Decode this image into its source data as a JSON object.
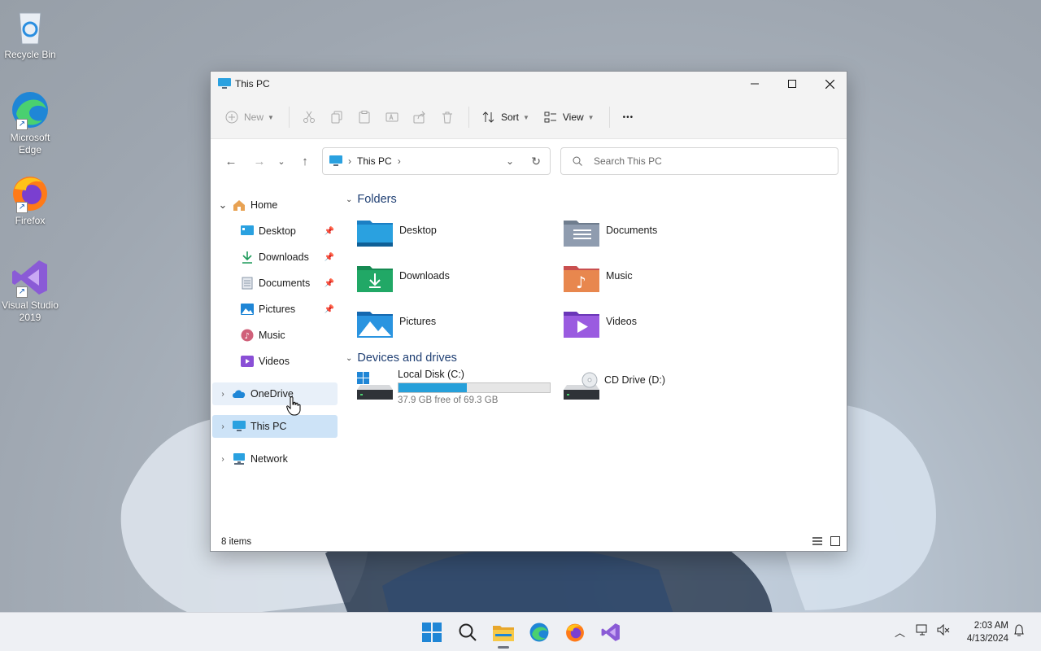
{
  "desktop": {
    "icons": [
      {
        "label": "Recycle Bin"
      },
      {
        "label": "Microsoft Edge"
      },
      {
        "label": "Firefox"
      },
      {
        "label": "Visual Studio 2019"
      }
    ]
  },
  "window": {
    "title": "This PC",
    "commandbar": {
      "new_label": "New",
      "sort_label": "Sort",
      "view_label": "View",
      "more_label": "•••"
    },
    "address": {
      "crumbs": [
        "This PC"
      ],
      "search_placeholder": "Search This PC"
    },
    "sidebar": {
      "home": "Home",
      "quick_access": [
        {
          "label": "Desktop",
          "pinned": true
        },
        {
          "label": "Downloads",
          "pinned": true
        },
        {
          "label": "Documents",
          "pinned": true
        },
        {
          "label": "Pictures",
          "pinned": true
        },
        {
          "label": "Music",
          "pinned": false
        },
        {
          "label": "Videos",
          "pinned": false
        }
      ],
      "onedrive": "OneDrive",
      "this_pc": "This PC",
      "network": "Network"
    },
    "content": {
      "folders_header": "Folders",
      "folders": [
        "Desktop",
        "Documents",
        "Downloads",
        "Music",
        "Pictures",
        "Videos"
      ],
      "drives_header": "Devices and drives",
      "drives": [
        {
          "name": "Local Disk (C:)",
          "free_text": "37.9 GB free of 69.3 GB",
          "used_fraction": 0.453
        },
        {
          "name": "CD Drive (D:)"
        }
      ]
    },
    "status": {
      "items_text": "8 items"
    }
  },
  "taskbar": {
    "time": "2:03 AM",
    "date": "4/13/2024"
  },
  "colors": {
    "accent": "#0078d4",
    "selected": "#cde3f7",
    "hover": "#e8f0f9",
    "drive_bar": "#26a0da"
  }
}
